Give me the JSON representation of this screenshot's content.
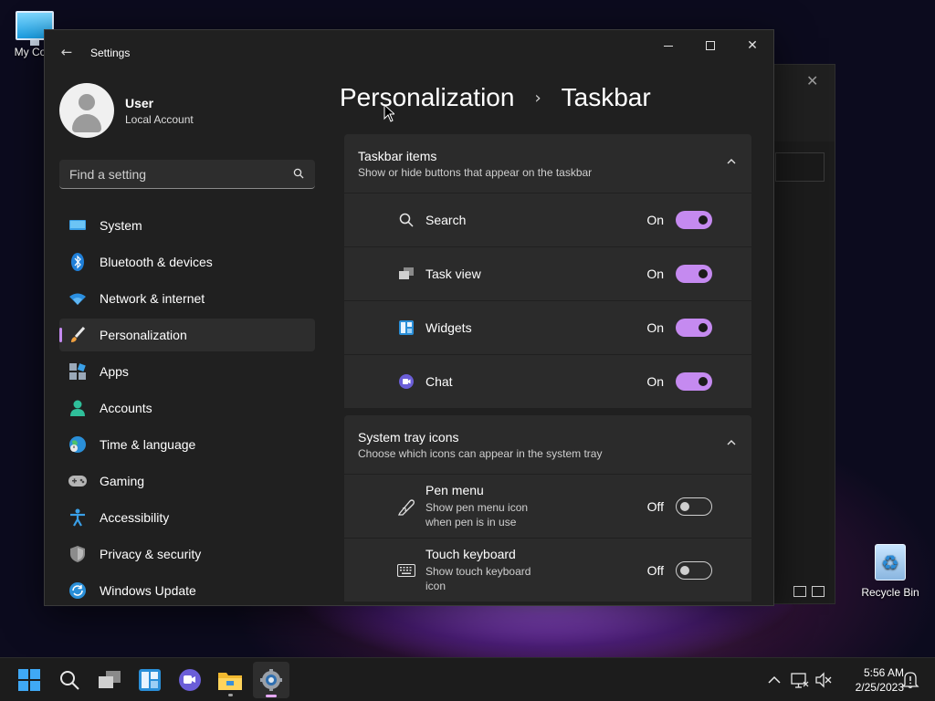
{
  "desktop": {
    "icons": [
      {
        "label": "My Com"
      },
      {
        "label": "Recycle Bin"
      }
    ]
  },
  "window": {
    "app_title": "Settings",
    "controls": {
      "minimize": "minimize",
      "maximize": "maximize",
      "close": "close"
    }
  },
  "profile": {
    "name": "User",
    "account_type": "Local Account"
  },
  "search": {
    "placeholder": "Find a setting",
    "value": ""
  },
  "sidebar": {
    "items": [
      {
        "label": "System",
        "icon": "system-icon",
        "active": false
      },
      {
        "label": "Bluetooth & devices",
        "icon": "bluetooth-icon",
        "active": false
      },
      {
        "label": "Network & internet",
        "icon": "wifi-icon",
        "active": false
      },
      {
        "label": "Personalization",
        "icon": "brush-icon",
        "active": true
      },
      {
        "label": "Apps",
        "icon": "apps-icon",
        "active": false
      },
      {
        "label": "Accounts",
        "icon": "accounts-icon",
        "active": false
      },
      {
        "label": "Time & language",
        "icon": "globe-icon",
        "active": false
      },
      {
        "label": "Gaming",
        "icon": "gamepad-icon",
        "active": false
      },
      {
        "label": "Accessibility",
        "icon": "accessibility-icon",
        "active": false
      },
      {
        "label": "Privacy & security",
        "icon": "shield-icon",
        "active": false
      },
      {
        "label": "Windows Update",
        "icon": "update-icon",
        "active": false
      }
    ]
  },
  "breadcrumb": {
    "parent": "Personalization",
    "current": "Taskbar"
  },
  "taskbar_items": {
    "title": "Taskbar items",
    "subtitle": "Show or hide buttons that appear on the taskbar",
    "rows": [
      {
        "label": "Search",
        "state": "On",
        "on": true
      },
      {
        "label": "Task view",
        "state": "On",
        "on": true
      },
      {
        "label": "Widgets",
        "state": "On",
        "on": true
      },
      {
        "label": "Chat",
        "state": "On",
        "on": true
      }
    ]
  },
  "system_tray": {
    "title": "System tray icons",
    "subtitle": "Choose which icons can appear in the system tray",
    "rows": [
      {
        "label": "Pen menu",
        "sub": "Show pen menu icon when pen is in use",
        "state": "Off",
        "on": false
      },
      {
        "label": "Touch keyboard",
        "sub": "Show touch keyboard icon",
        "state": "Off",
        "on": false
      }
    ]
  },
  "taskbar": {
    "clock_time": "5:56 AM",
    "clock_date": "2/25/2023"
  },
  "colors": {
    "accent": "#c58af0",
    "window_bg": "#202020",
    "card_bg": "#2b2b2b"
  }
}
